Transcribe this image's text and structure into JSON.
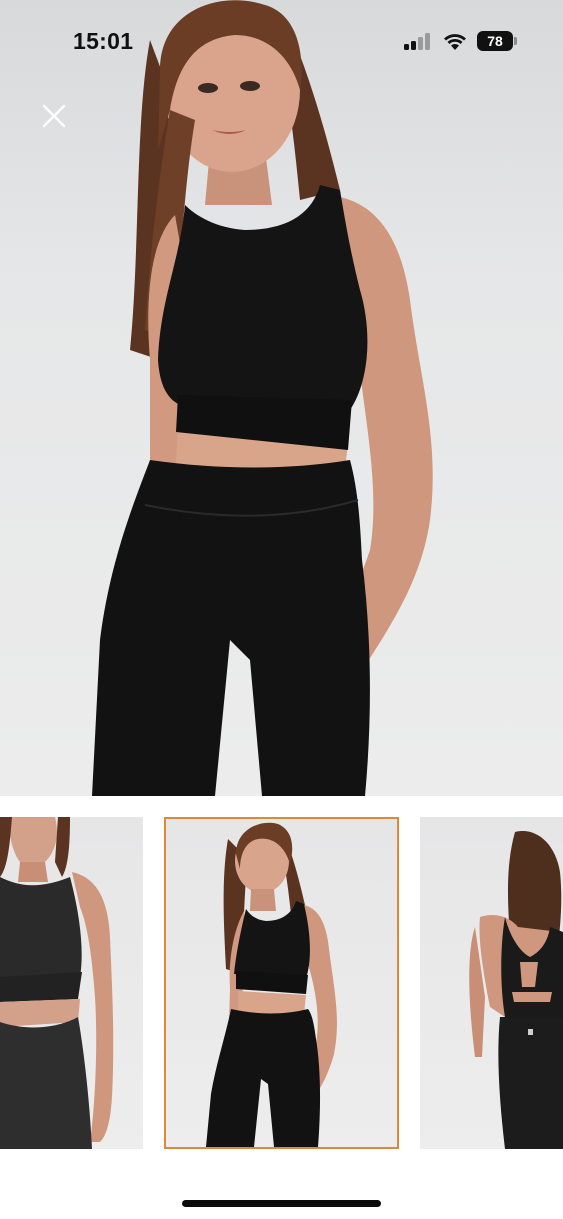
{
  "status_bar": {
    "time": "15:01",
    "battery_level": "78",
    "icons": [
      "cellular-signal-icon",
      "wifi-icon",
      "battery-icon"
    ]
  },
  "viewer": {
    "close_icon": "close-icon",
    "main_image": "product-photo-front",
    "thumbnails": [
      {
        "name": "thumbnail-front-closeup",
        "selected": false
      },
      {
        "name": "thumbnail-front-full",
        "selected": true
      },
      {
        "name": "thumbnail-back",
        "selected": false
      }
    ]
  },
  "colors": {
    "selected_thumbnail_border": "#d98a3d",
    "background": "#ffffff",
    "garment": "#141414"
  }
}
